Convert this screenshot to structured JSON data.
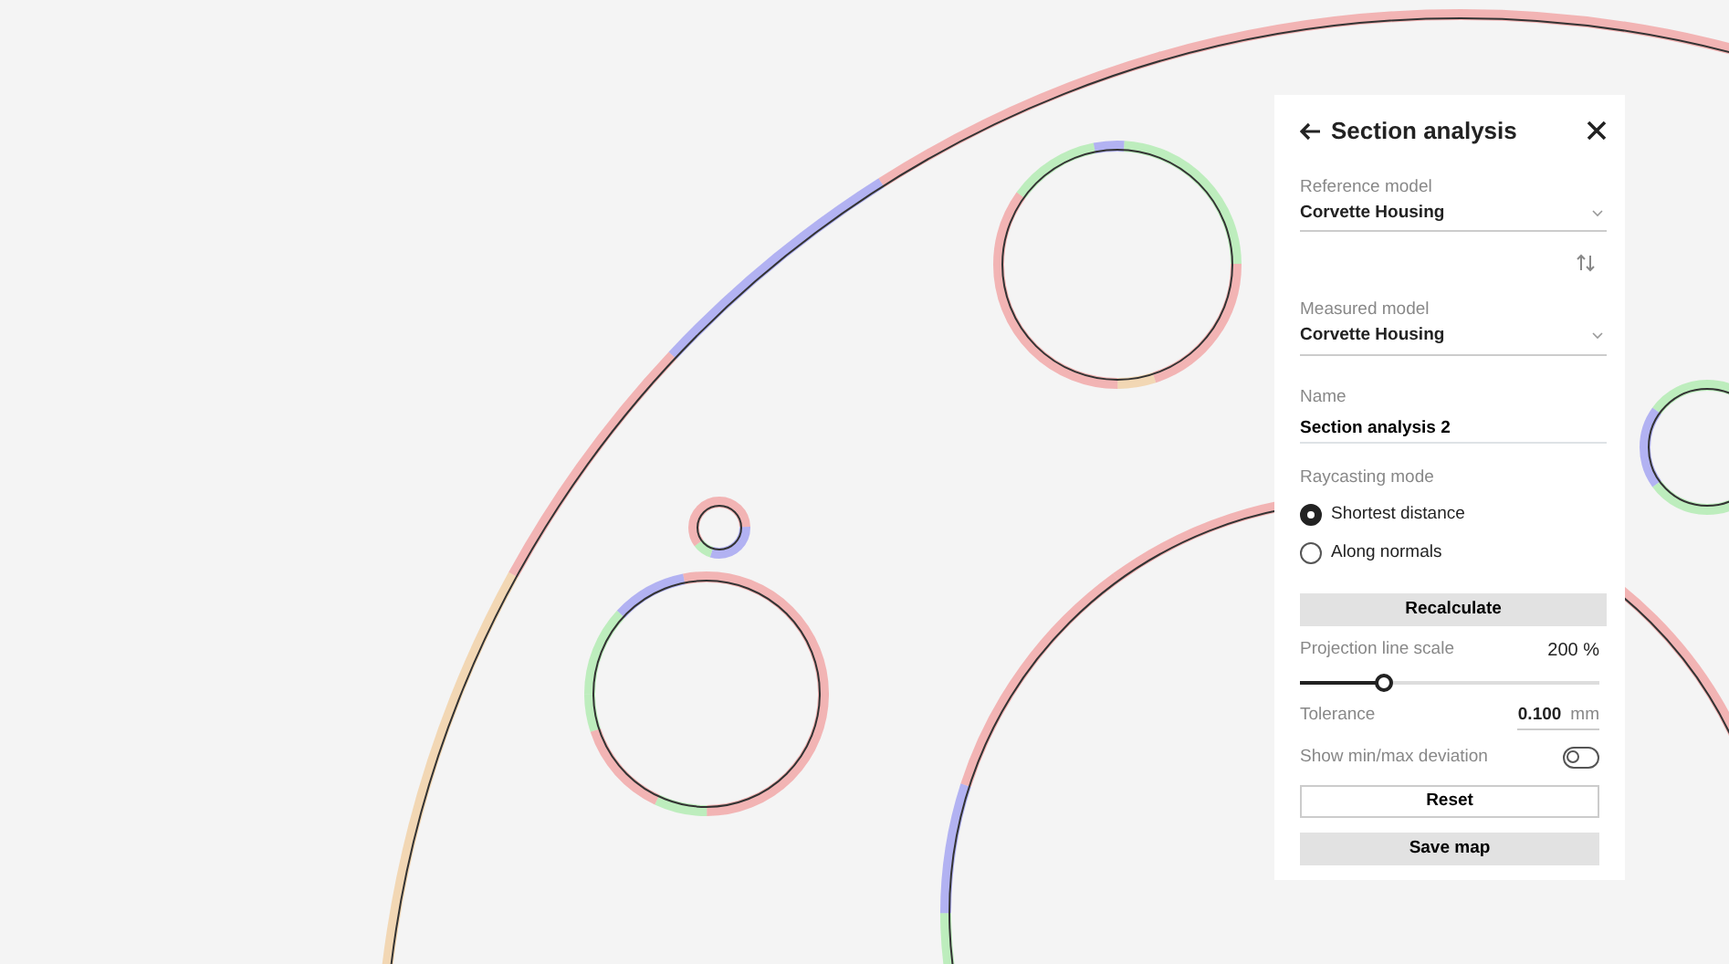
{
  "panel": {
    "title": "Section analysis",
    "reference_model": {
      "label": "Reference model",
      "value": "Corvette Housing"
    },
    "measured_model": {
      "label": "Measured model",
      "value": "Corvette Housing"
    },
    "name": {
      "label": "Name",
      "value": "Section analysis 2"
    },
    "raycasting": {
      "label": "Raycasting mode",
      "options": [
        {
          "label": "Shortest distance",
          "selected": true
        },
        {
          "label": "Along normals",
          "selected": false
        }
      ]
    },
    "recalculate": "Recalculate",
    "projection_scale": {
      "label": "Projection line scale",
      "reading": "200 %",
      "level": 0.28
    },
    "tolerance": {
      "label": "Tolerance",
      "value": "0.100",
      "unit": "mm"
    },
    "show_minmax": {
      "label": "Show min/max deviation",
      "on": false
    },
    "buttons": [
      {
        "label": "Reset",
        "kind": "outline"
      },
      {
        "label": "Save map",
        "kind": "filled"
      }
    ]
  }
}
